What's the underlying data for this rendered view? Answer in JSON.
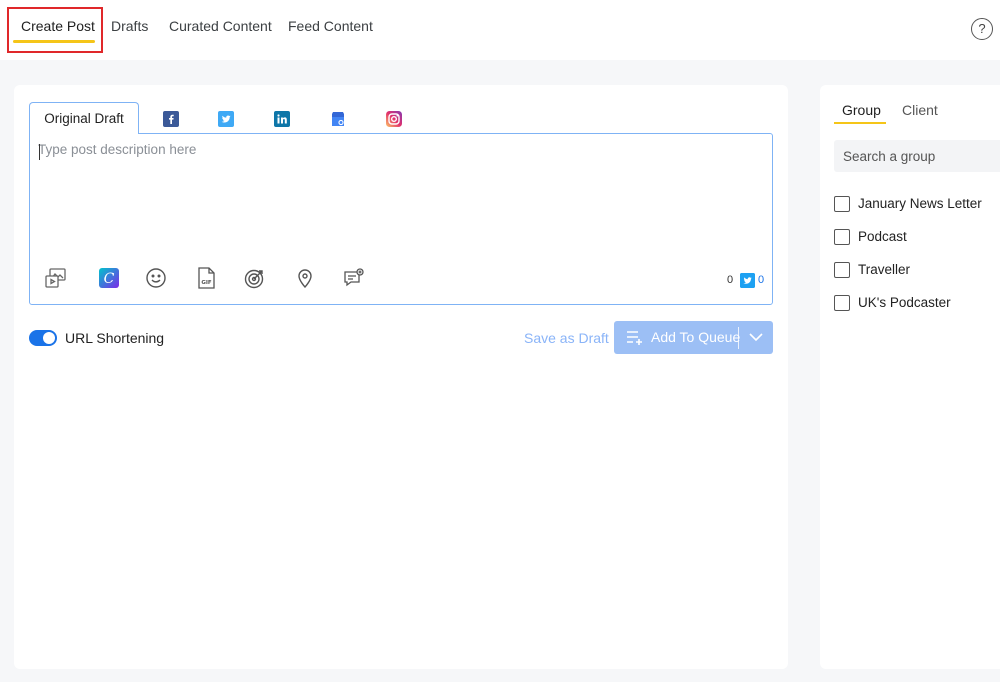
{
  "nav": {
    "tabs": [
      {
        "label": "Create Post"
      },
      {
        "label": "Drafts"
      },
      {
        "label": "Curated Content"
      },
      {
        "label": "Feed Content"
      }
    ],
    "help_glyph": "?"
  },
  "composer": {
    "active_tab": "Original Draft",
    "networks": [
      {
        "icon": "facebook-icon",
        "glyph": "f",
        "color": "#3b5998"
      },
      {
        "icon": "twitter-icon",
        "glyph": "t",
        "color": "#1da1f2"
      },
      {
        "icon": "linkedin-icon",
        "glyph": "in",
        "color": "#0e76a8"
      },
      {
        "icon": "google-my-business-icon",
        "glyph": "G",
        "color": "#4285f4"
      },
      {
        "icon": "instagram-icon",
        "glyph": "◎",
        "color": "#e1306c"
      }
    ],
    "placeholder": "Type post description here",
    "value": "",
    "toolbar_icons": [
      "media-icon",
      "canva-icon",
      "emoji-icon",
      "gif-icon",
      "target-icon",
      "location-icon",
      "comment-icon"
    ],
    "char_count": "0",
    "twitter_count": "0"
  },
  "actions": {
    "url_shortening_label": "URL Shortening",
    "url_shortening_on": true,
    "save_draft_label": "Save as Draft",
    "add_queue_label": "Add To Queue"
  },
  "sidebar": {
    "tabs": [
      {
        "label": "Group"
      },
      {
        "label": "Client"
      }
    ],
    "search_placeholder": "Search a group",
    "groups": [
      {
        "name": "January News Letter",
        "checked": false
      },
      {
        "name": "Podcast",
        "checked": false
      },
      {
        "name": "Traveller",
        "checked": false
      },
      {
        "name": "UK's Podcaster",
        "checked": false
      }
    ]
  },
  "colors": {
    "accent": "#1a73e8",
    "tab_underline": "#f5c518",
    "highlight_box": "#e0282a",
    "queue_button": "#9cbff5"
  }
}
